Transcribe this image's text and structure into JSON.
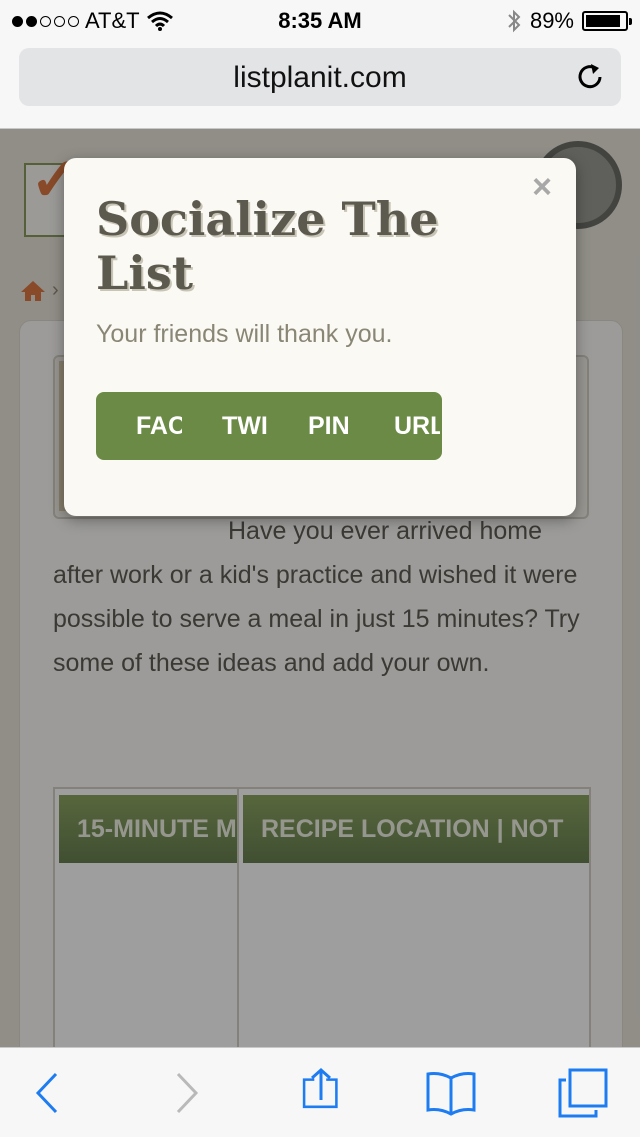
{
  "status_bar": {
    "carrier": "AT&T",
    "time": "8:35 AM",
    "battery_text": "89%",
    "battery_level": 0.89,
    "signal_bars_filled": 2,
    "signal_bars_total": 5
  },
  "browser": {
    "url": "listplanit.com"
  },
  "page": {
    "description": "Have you ever arrived home after work or a kid's practice and wished it were possible to serve a meal in just 15 minutes?  Try some of these ideas and add your own.",
    "table_headers": [
      "15-MINUTE M",
      "RECIPE LOCATION | NOT"
    ]
  },
  "modal": {
    "close_glyph": "×",
    "title": "Socialize The List",
    "subtitle": "Your friends will thank you.",
    "share_buttons": [
      "FAC",
      "TWI",
      "PIN",
      "URL"
    ]
  },
  "colors": {
    "accent_green": "#6a8a45",
    "logo_orange": "#d8662a",
    "ios_blue": "#1e7cf2"
  },
  "icons": {
    "reload": "reload-icon",
    "home": "home-icon",
    "back": "back-icon",
    "forward": "forward-icon",
    "share": "share-icon",
    "bookmarks": "bookmarks-icon",
    "tabs": "tabs-icon"
  }
}
